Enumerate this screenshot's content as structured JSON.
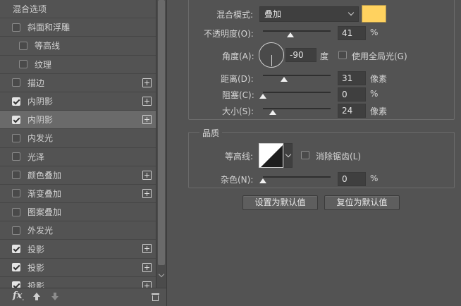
{
  "styles_panel": {
    "header": "混合选项",
    "items": [
      {
        "label": "斜面和浮雕",
        "checked": false,
        "sub": false,
        "plus": false,
        "selected": false
      },
      {
        "label": "等高线",
        "checked": false,
        "sub": true,
        "plus": false,
        "selected": false
      },
      {
        "label": "纹理",
        "checked": false,
        "sub": true,
        "plus": false,
        "selected": false
      },
      {
        "label": "描边",
        "checked": false,
        "sub": false,
        "plus": true,
        "selected": false
      },
      {
        "label": "内阴影",
        "checked": true,
        "sub": false,
        "plus": true,
        "selected": false
      },
      {
        "label": "内阴影",
        "checked": true,
        "sub": false,
        "plus": true,
        "selected": true
      },
      {
        "label": "内发光",
        "checked": false,
        "sub": false,
        "plus": false,
        "selected": false
      },
      {
        "label": "光泽",
        "checked": false,
        "sub": false,
        "plus": false,
        "selected": false
      },
      {
        "label": "颜色叠加",
        "checked": false,
        "sub": false,
        "plus": true,
        "selected": false
      },
      {
        "label": "渐变叠加",
        "checked": false,
        "sub": false,
        "plus": true,
        "selected": false
      },
      {
        "label": "图案叠加",
        "checked": false,
        "sub": false,
        "plus": false,
        "selected": false
      },
      {
        "label": "外发光",
        "checked": false,
        "sub": false,
        "plus": false,
        "selected": false
      },
      {
        "label": "投影",
        "checked": true,
        "sub": false,
        "plus": true,
        "selected": false
      },
      {
        "label": "投影",
        "checked": true,
        "sub": false,
        "plus": true,
        "selected": false
      },
      {
        "label": "投影",
        "checked": true,
        "sub": false,
        "plus": true,
        "selected": false
      }
    ],
    "toolbar": {
      "fx_label": "fx",
      "fx_suffix": "."
    }
  },
  "structure": {
    "blend_mode_label": "混合模式:",
    "blend_mode_value": "叠加",
    "shadow_color": "#ffd25f",
    "opacity_label": "不透明度(O):",
    "opacity_value": "41",
    "opacity_unit": "%",
    "angle_label": "角度(A):",
    "angle_value": "-90",
    "angle_unit": "度",
    "global_light_label": "使用全局光(G)",
    "global_light_checked": false,
    "distance_label": "距离(D):",
    "distance_value": "31",
    "distance_unit": "像素",
    "choke_label": "阻塞(C):",
    "choke_value": "0",
    "choke_unit": "%",
    "size_label": "大小(S):",
    "size_value": "24",
    "size_unit": "像素"
  },
  "quality": {
    "title": "品质",
    "contour_label": "等高线:",
    "anti_alias_label": "消除锯齿(L)",
    "anti_alias_checked": false,
    "noise_label": "杂色(N):",
    "noise_value": "0",
    "noise_unit": "%"
  },
  "buttons": {
    "make_default": "设置为默认值",
    "reset_default": "复位为默认值"
  }
}
